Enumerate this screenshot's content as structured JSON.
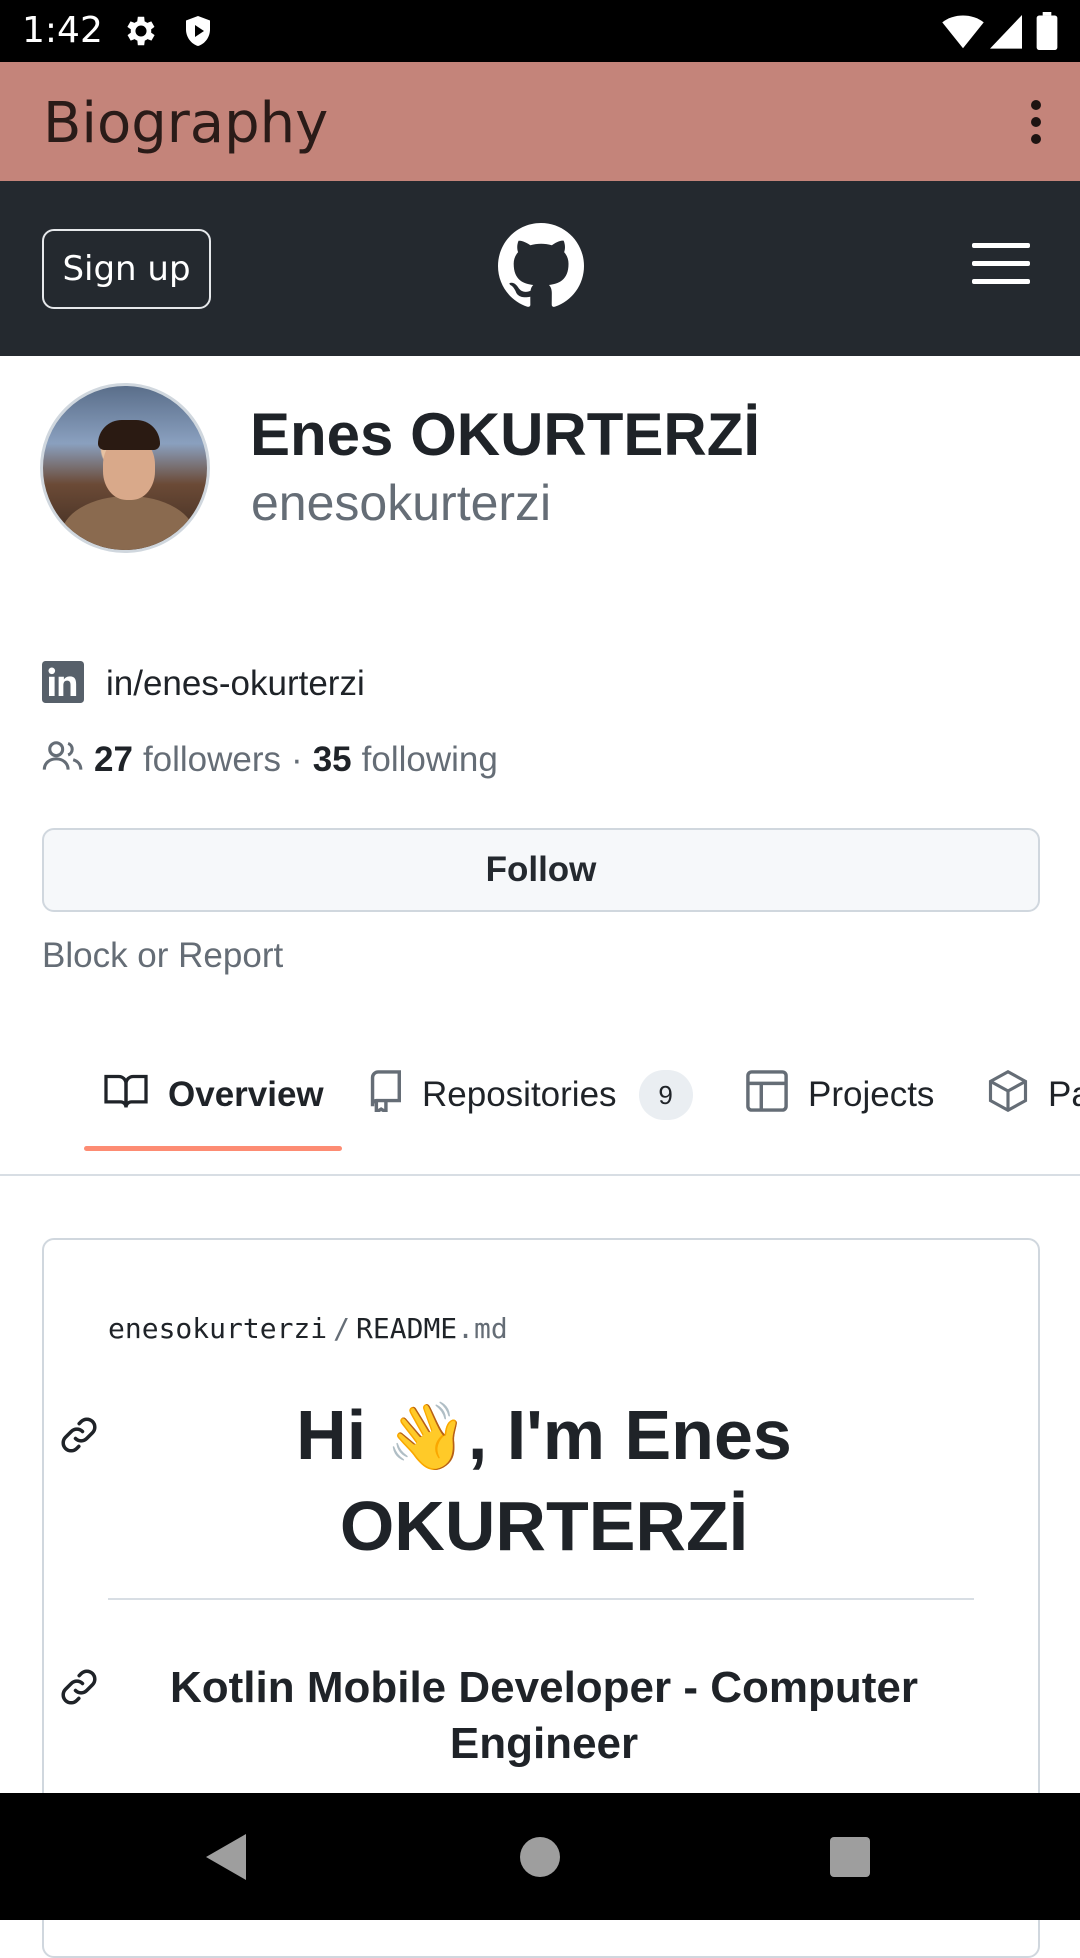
{
  "status_bar": {
    "time": "1:42",
    "icons": [
      "settings-icon",
      "shield-play-icon",
      "wifi-icon",
      "signal-icon",
      "battery-icon"
    ]
  },
  "app_bar": {
    "title": "Biography",
    "menu_icon": "more-vert-icon",
    "background": "#c4847a"
  },
  "gh_header": {
    "signup_label": "Sign up",
    "logo_icon": "github-mark-icon",
    "menu_icon": "hamburger-icon",
    "background": "#24292f"
  },
  "profile": {
    "name": "Enes OKURTERZİ",
    "login": "enesokurterzi",
    "linkedin": "in/enes-okurterzi",
    "followers_count": "27",
    "followers_label": "followers",
    "separator": "·",
    "following_count": "35",
    "following_label": "following",
    "follow_button": "Follow",
    "block_report": "Block or Report"
  },
  "tabs": [
    {
      "label": "Overview",
      "icon": "book-icon",
      "active": true
    },
    {
      "label": "Repositories",
      "icon": "repo-icon",
      "count": "9"
    },
    {
      "label": "Projects",
      "icon": "table-icon"
    },
    {
      "label": "Pa",
      "icon": "package-icon"
    }
  ],
  "readme": {
    "owner": "enesokurterzi",
    "path_sep": "/",
    "file": "README",
    "ext": ".md",
    "heading_part1": "Hi ",
    "wave": "👋",
    "heading_part2": ", I'm Enes",
    "heading_line2": "OKURTERZİ",
    "subheading_line1": "Kotlin Mobile Developer - Computer",
    "subheading_line2": "Engineer"
  },
  "colors": {
    "accent_underline": "#fd8c73",
    "muted_text": "#656d76",
    "border": "#d0d7de"
  }
}
